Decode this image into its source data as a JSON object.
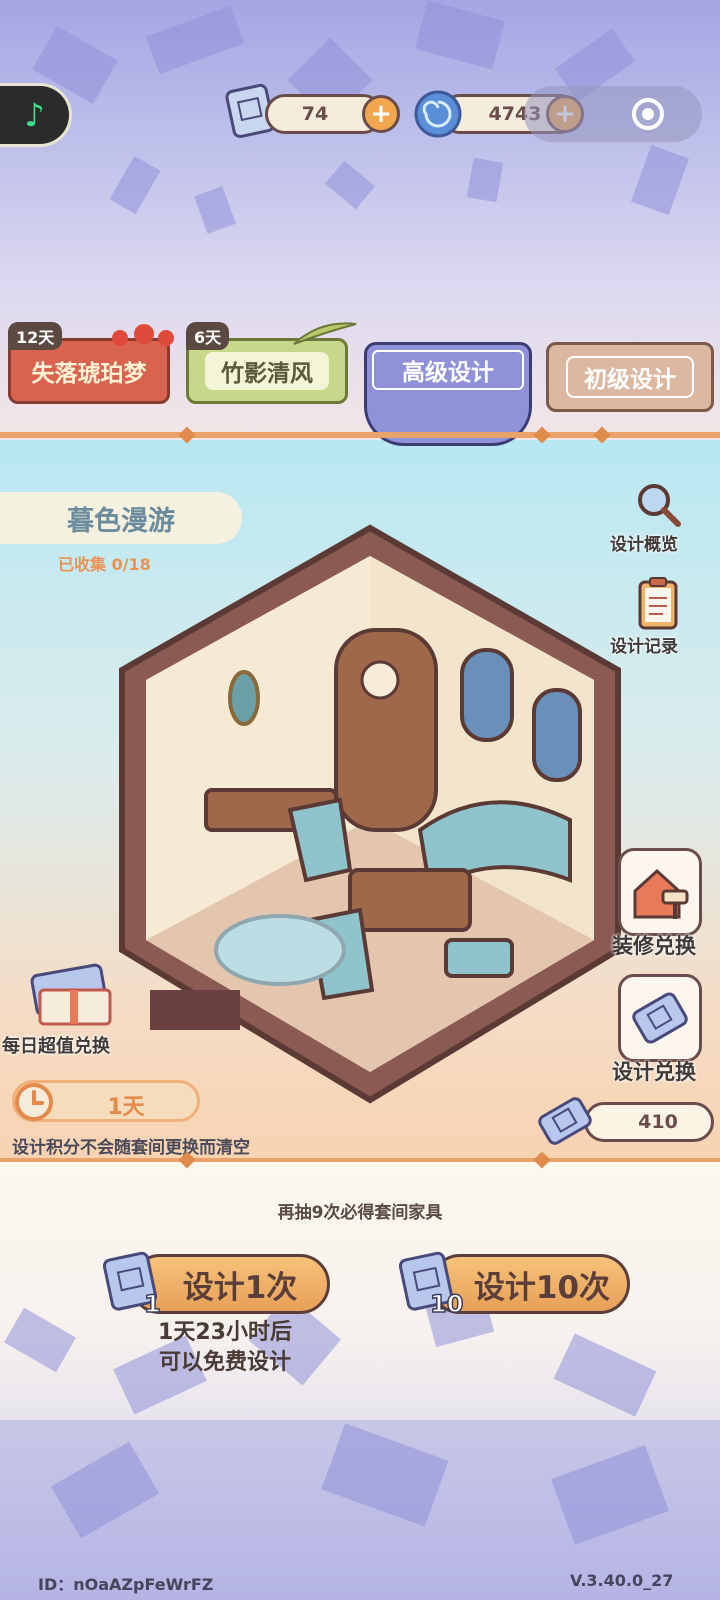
{
  "currency": {
    "scrolls": "74",
    "gems": "4743"
  },
  "tabs": [
    {
      "label": "失落琥珀梦",
      "badge": "12天"
    },
    {
      "label": "竹影清风",
      "badge": "6天"
    },
    {
      "label": "高级设计",
      "badge": ""
    },
    {
      "label": "初级设计",
      "badge": ""
    }
  ],
  "collection": {
    "title": "暮色漫游",
    "progress": "已收集 0/18"
  },
  "side_menu": {
    "overview": "设计概览",
    "records": "设计记录",
    "decor_exchange": "装修兑换",
    "design_exchange": "设计兑换"
  },
  "daily_deal": {
    "label": "每日超值兑换",
    "timer": "1天"
  },
  "notice": "设计积分不会随套间更换而清空",
  "design_points": "410",
  "pity_text": "再抽9次必得套间家具",
  "design_once": {
    "label": "设计1次",
    "cost": "1"
  },
  "design_ten": {
    "label": "设计10次",
    "cost": "10"
  },
  "free_timer": {
    "line1": "1天23小时后",
    "line2": "可以免费设计"
  },
  "footer": {
    "player_id": "ID：nOaAZpFeWrFZ",
    "version": "V.3.40.0_27"
  },
  "colors": {
    "accent_orange": "#f2a64e",
    "outline_brown": "#6b4c4c",
    "tab_active": "#8f92d9"
  }
}
